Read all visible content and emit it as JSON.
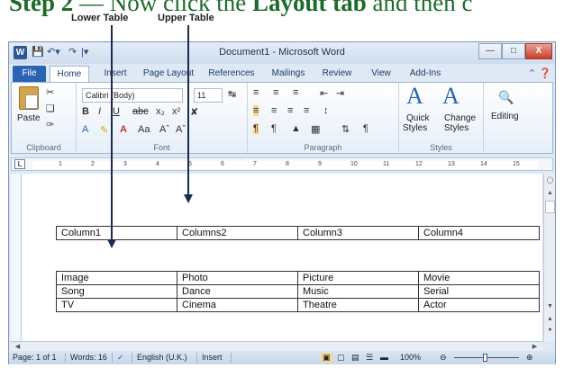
{
  "tutorial": {
    "step_text_a": "Step 2",
    "step_text_b": " — Now click the ",
    "step_text_c": "Layout tab",
    "step_text_d": " and then c",
    "label_lower": "Lower Table",
    "label_upper": "Upper Table"
  },
  "window": {
    "title": "Document1 - Microsoft Word",
    "minimize": "—",
    "maximize": "□",
    "close": "X"
  },
  "tabs": [
    "File",
    "Home",
    "Insert",
    "Page Layout",
    "References",
    "Mailings",
    "Review",
    "View",
    "Add-Ins"
  ],
  "ribbon": {
    "clipboard": {
      "paste": "Paste",
      "label": "Clipboard"
    },
    "font": {
      "name": "Calibri (Body)",
      "size": "11",
      "label": "Font"
    },
    "paragraph": {
      "label": "Paragraph"
    },
    "styles": {
      "quick": "Quick",
      "quick2": "Styles",
      "change": "Change",
      "change2": "Styles",
      "label": "Styles"
    },
    "editing": {
      "label": "Editing"
    }
  },
  "ruler_numbers": [
    "1",
    "2",
    "3",
    "4",
    "5",
    "6",
    "7",
    "8",
    "9",
    "10",
    "11",
    "12",
    "13",
    "14",
    "15"
  ],
  "upper_table": [
    [
      "Column1",
      "Columns2",
      "Column3",
      "Column4"
    ]
  ],
  "lower_table": [
    [
      "Image",
      "Photo",
      "Picture",
      "Movie"
    ],
    [
      "Song",
      "Dance",
      "Music",
      "Serial"
    ],
    [
      "TV",
      "Cinema",
      "Theatre",
      "Actor"
    ]
  ],
  "statusbar": {
    "page": "Page: 1 of 1",
    "words": "Words: 16",
    "language": "English (U.K.)",
    "mode": "Insert",
    "zoom": "100%"
  }
}
